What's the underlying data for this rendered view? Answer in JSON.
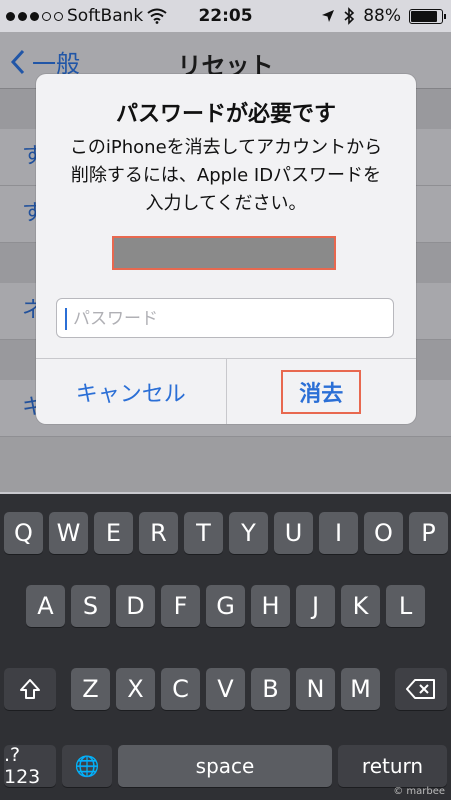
{
  "status_bar": {
    "carrier": "SoftBank",
    "time": "22:05",
    "battery": "88%",
    "battery_level": 0.88,
    "icons": [
      "signal-dots",
      "wifi-icon",
      "location-arrow-icon",
      "bluetooth-icon",
      "battery-icon"
    ]
  },
  "nav": {
    "back_label": "一般",
    "title": "リセット"
  },
  "background_list": {
    "cells": [
      "す",
      "す",
      "ネ",
      "キーボードの変換学習をリセット"
    ]
  },
  "alert": {
    "title": "パスワードが必要です",
    "message_lines": [
      "このiPhoneを消去してアカウントから",
      "削除するには、Apple IDパスワードを",
      "入力してください。"
    ],
    "password_placeholder": "パスワード",
    "password_value": "",
    "cancel_label": "キャンセル",
    "erase_label": "消去"
  },
  "keyboard": {
    "row1": [
      "Q",
      "W",
      "E",
      "R",
      "T",
      "Y",
      "U",
      "I",
      "O",
      "P"
    ],
    "row2": [
      "A",
      "S",
      "D",
      "F",
      "G",
      "H",
      "J",
      "K",
      "L"
    ],
    "row3": [
      "Z",
      "X",
      "C",
      "V",
      "B",
      "N",
      "M"
    ],
    "shift_icon": "shift-icon",
    "delete_icon": "delete-icon",
    "mode_label": ".?123",
    "globe_label": "🌐",
    "space_label": "space",
    "return_label": "return"
  },
  "watermark": "© marbee",
  "colors": {
    "accent": "#2b6fd6",
    "highlight": "#e8684f"
  }
}
